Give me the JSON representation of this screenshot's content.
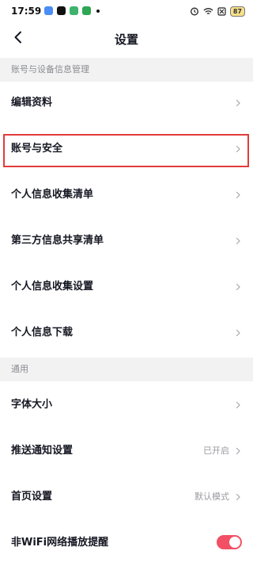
{
  "status_bar": {
    "time": "17:59",
    "battery": "87",
    "app_icon_colors": [
      "#4a8df5",
      "#111111",
      "#3db36b",
      "#2ea653"
    ]
  },
  "header": {
    "back_icon": "chevron-left-icon",
    "title": "设置"
  },
  "sections": {
    "account": {
      "header": "账号与设备信息管理",
      "items": [
        {
          "label": "编辑资料"
        },
        {
          "label": "账号与安全"
        },
        {
          "label": "个人信息收集清单"
        },
        {
          "label": "第三方信息共享清单"
        },
        {
          "label": "个人信息收集设置"
        },
        {
          "label": "个人信息下载"
        }
      ]
    },
    "general": {
      "header": "通用",
      "items": [
        {
          "label": "字体大小"
        },
        {
          "label": "推送通知设置",
          "value": "已开启"
        },
        {
          "label": "首页设置",
          "value": "默认模式"
        },
        {
          "label": "非WiFi网络播放提醒",
          "toggle_on": true
        }
      ]
    }
  },
  "colors": {
    "accent_toggle": "#f25065",
    "highlight_border": "#e23b3b"
  }
}
